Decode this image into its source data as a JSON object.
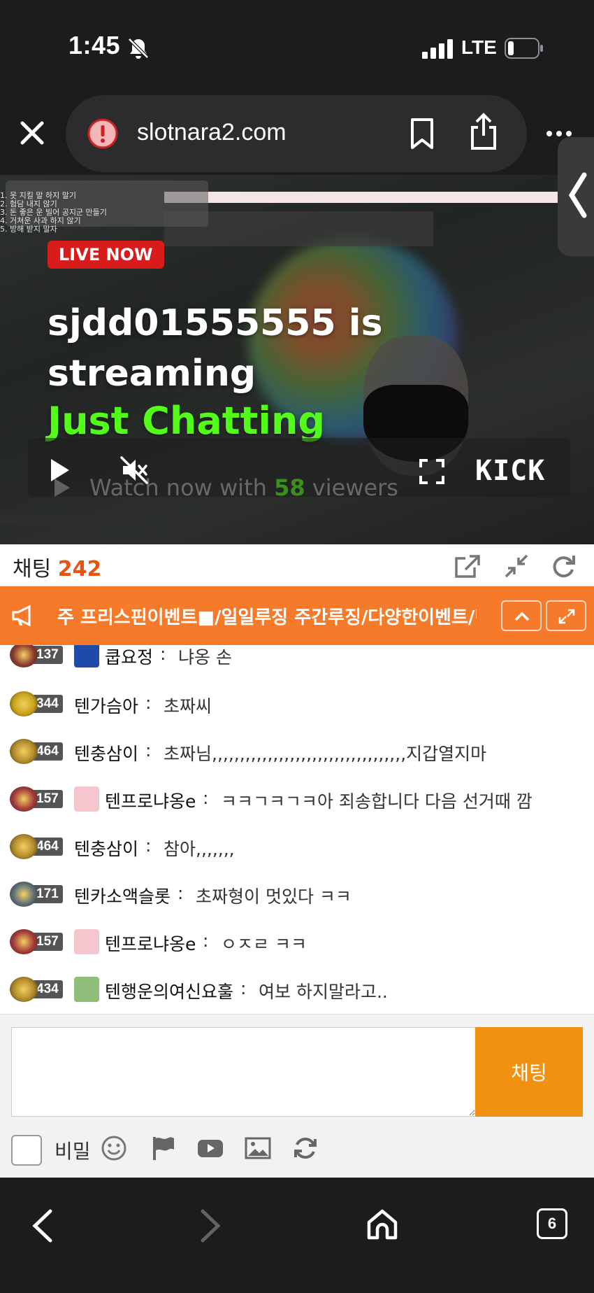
{
  "status": {
    "time": "1:45",
    "network": "LTE"
  },
  "browser": {
    "url": "slotnara2.com",
    "tab_count": "6"
  },
  "stream": {
    "live_label": "LIVE NOW",
    "title": "sjdd01555555 is streaming",
    "category": "Just Chatting",
    "watch_prefix": "Watch now with",
    "viewers": "58",
    "watch_suffix": "viewers",
    "platform": "KICK",
    "overlay_lines": [
      "1. 못 지킬 말 하지 말기",
      "2. 험담 내지 않기",
      "3. 돈 좋은 운 빌어 공지군 만들기",
      "4. 거쳐운 사과 하지 않기",
      "5. 방해 받지 말자"
    ]
  },
  "chat": {
    "title": "채팅",
    "count": "242",
    "notice": "주 프리스핀이벤트■/일일루징 주간루징/다양한이벤트/텐키",
    "messages": [
      {
        "level": "137",
        "user": "쿱요정",
        "text": "냐옹 손",
        "badge_color": "#8a3b2e",
        "avatar": "blue"
      },
      {
        "level": "344",
        "user": "텐가슴아",
        "text": "초짜씨",
        "badge_color": "#c9a21a",
        "avatar": ""
      },
      {
        "level": "464",
        "user": "텐충삼이",
        "text": "초짜님,,,,,,,,,,,,,,,,,,,,,,,,,,,,,,,,,,,지갑열지마",
        "badge_color": "#b08a2a",
        "avatar": ""
      },
      {
        "level": "157",
        "user": "텐프로냐옹e",
        "text": "ㅋㅋㄱㅋㄱㅋ아 죄송합니다 다음 선거때 깜",
        "badge_color": "#a33a3a",
        "avatar": "pink"
      },
      {
        "level": "464",
        "user": "텐충삼이",
        "text": "참아,,,,,,,",
        "badge_color": "#b08a2a",
        "avatar": ""
      },
      {
        "level": "171",
        "user": "텐카소액슬롯",
        "text": "초짜형이 멋있다 ㅋㅋ",
        "badge_color": "#5a6f7a",
        "avatar": ""
      },
      {
        "level": "157",
        "user": "텐프로냐옹e",
        "text": "ㅇㅈㄹ ㅋㅋ",
        "badge_color": "#a33a3a",
        "avatar": "pink"
      },
      {
        "level": "434",
        "user": "텐행운의여신요훌",
        "text": "여보 하지말라고..",
        "badge_color": "#b08a2a",
        "avatar": "green"
      }
    ],
    "separator": ":",
    "send_label": "채팅",
    "secret_label": "비밀",
    "input_value": ""
  },
  "colors": {
    "accent": "#f0920f",
    "notice": "#f57a2a",
    "count": "#e8540e",
    "kick_green": "#53fc18",
    "live_red": "#d81b1b"
  },
  "icons": [
    "bell-slash-icon",
    "signal-icon",
    "battery-icon",
    "close-icon",
    "warning-icon",
    "bookmark-icon",
    "share-icon",
    "more-icon",
    "play-icon",
    "mute-icon",
    "fullscreen-icon",
    "popout-icon",
    "shrink-icon",
    "refresh-icon",
    "megaphone-icon",
    "emoji-icon",
    "flag-icon",
    "youtube-icon",
    "image-icon",
    "reload-icon",
    "back-icon",
    "forward-icon",
    "home-icon",
    "tabs-icon"
  ]
}
